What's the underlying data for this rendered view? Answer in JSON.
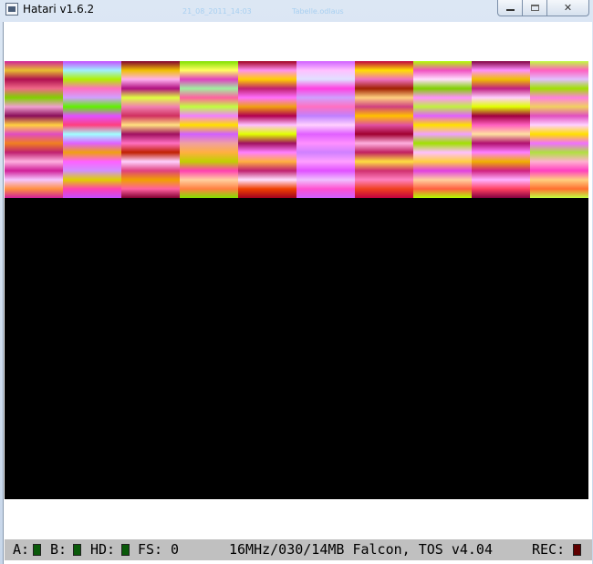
{
  "window": {
    "title": "Hatari v1.6.2",
    "ghost_text_1": "21_08_2011_14:03",
    "ghost_text_2": "Tabelle.odlaus",
    "close_glyph": "✕"
  },
  "emulator_screen": {
    "bar_columns": [
      [
        "#d0209a",
        "#e8c030",
        "#b01050",
        "#f06888",
        "#80d000",
        "#f0a0d0",
        "#8a0e5a",
        "#ffd040",
        "#e04cc0",
        "#f08020",
        "#c02070",
        "#ffb0e0",
        "#d02098",
        "#f5c5ff",
        "#ff9040"
      ],
      [
        "#c44cff",
        "#a0f0ff",
        "#b0f000",
        "#ff70c0",
        "#d0a0ff",
        "#60f000",
        "#e050ff",
        "#ff4080",
        "#a0ffff",
        "#e060ff",
        "#f0a010",
        "#ff60ff",
        "#d090ff",
        "#e0d000",
        "#ff40b0"
      ],
      [
        "#800030",
        "#f0c000",
        "#ffb0f0",
        "#b01080",
        "#e0ff40",
        "#f080b0",
        "#d03060",
        "#ffe080",
        "#a01060",
        "#ff70c0",
        "#c02000",
        "#ffd0ff",
        "#e04080",
        "#f0a000",
        "#ff60a0"
      ],
      [
        "#80e000",
        "#ffff60",
        "#e040c0",
        "#a0f0a0",
        "#ff60a0",
        "#c0ff40",
        "#f080ff",
        "#ffe000",
        "#d060ff",
        "#f0a0a0",
        "#ffb040",
        "#c0d000",
        "#ff40b0",
        "#ffd0a0",
        "#ff8040"
      ],
      [
        "#a00020",
        "#ff90f0",
        "#ffd000",
        "#c02070",
        "#ff70ff",
        "#f0a010",
        "#b00050",
        "#ffc0ff",
        "#e0ff00",
        "#a01060",
        "#ff80ff",
        "#ffb040",
        "#c02070",
        "#ffe0ff",
        "#f04000"
      ],
      [
        "#d060ff",
        "#ffc0ff",
        "#e0e0ff",
        "#ff40e0",
        "#d0a0ff",
        "#ff70c0",
        "#c080ff",
        "#ffd0ff",
        "#e060ff",
        "#ff90ff",
        "#d080ff",
        "#ffa0ff",
        "#e050ff",
        "#f0c0ff",
        "#ff50d0"
      ],
      [
        "#c00040",
        "#ffe000",
        "#f070c0",
        "#a02000",
        "#ffd080",
        "#d04080",
        "#ffc000",
        "#e050a0",
        "#a00030",
        "#ffb0e0",
        "#c02060",
        "#ffe040",
        "#d03070",
        "#ff80c0",
        "#f04020"
      ],
      [
        "#b0ff00",
        "#f050c0",
        "#ffe0ff",
        "#80d000",
        "#ff90ff",
        "#c0f040",
        "#e060ff",
        "#ffe000",
        "#f0a0ff",
        "#a0e000",
        "#ffc0ff",
        "#ffd040",
        "#e040e0",
        "#ffd0a0",
        "#ff6040"
      ],
      [
        "#800040",
        "#ff90ff",
        "#f0c000",
        "#c02080",
        "#ffd0ff",
        "#e0ff00",
        "#a00040",
        "#ff60c0",
        "#ffe0a0",
        "#b01070",
        "#ff80ff",
        "#f0b000",
        "#d02080",
        "#ffb0ff",
        "#ff4060"
      ],
      [
        "#c0ff40",
        "#ff60c0",
        "#e0c0ff",
        "#a0e000",
        "#ff80e0",
        "#f0d060",
        "#e050c0",
        "#ffd0ff",
        "#ffe000",
        "#f070ff",
        "#b0e040",
        "#ffb0d0",
        "#ff40c0",
        "#ffd080",
        "#ff7030"
      ]
    ]
  },
  "statusbar": {
    "drive_a": "A:",
    "drive_b": "B:",
    "drive_hd": "HD:",
    "fs_label": "FS:",
    "fs_value": "0",
    "machine_info": "16MHz/030/14MB Falcon, TOS v4.04",
    "rec_label": "REC:",
    "led_on_color": "#0a5a0a",
    "rec_color": "#600000"
  }
}
